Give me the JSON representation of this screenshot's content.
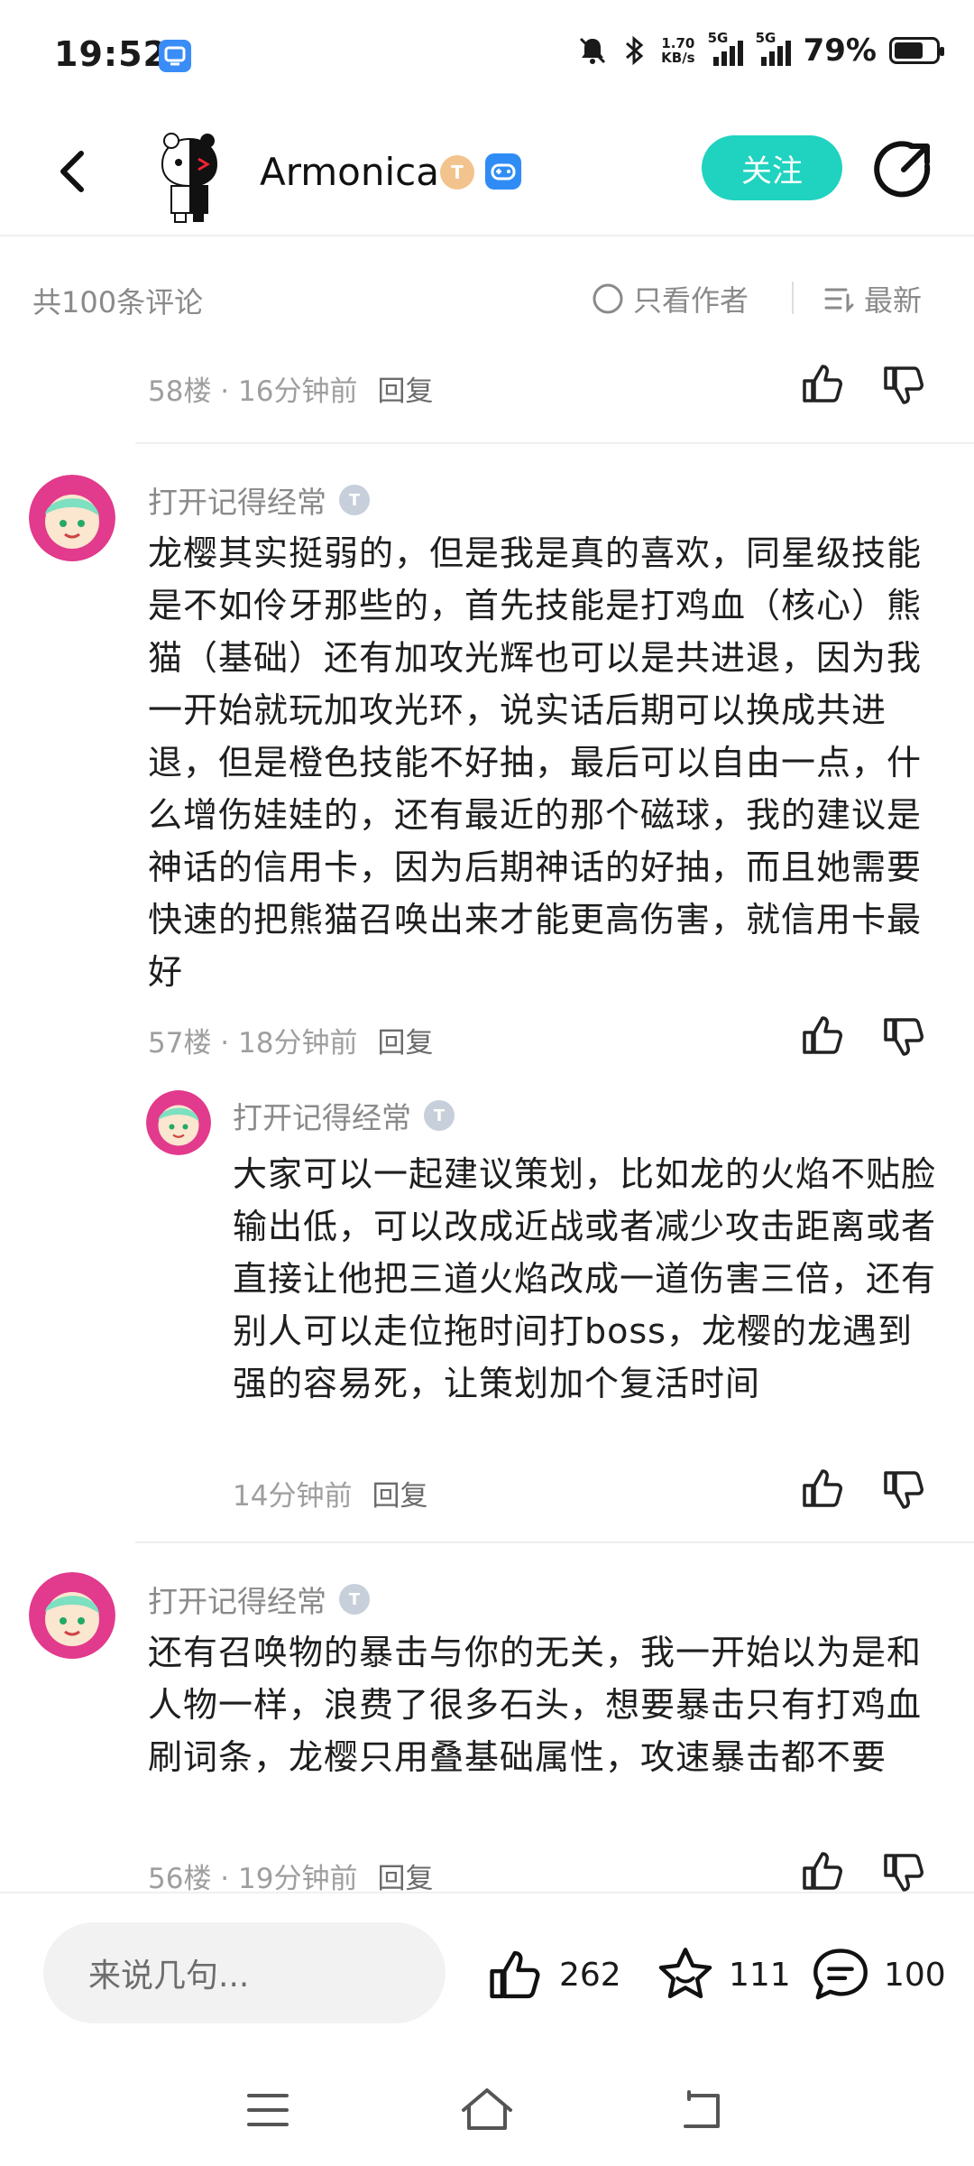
{
  "status_bar": {
    "time": "19:52",
    "net_speed_top": "1.70",
    "net_speed_unit": "KB/s",
    "signal_1": "5G",
    "signal_2": "5G",
    "battery": "79%"
  },
  "header": {
    "username": "Armonica",
    "badge_level": "T",
    "follow_label": "关注"
  },
  "comment_bar": {
    "total": "共100条评论",
    "author_only": "只看作者",
    "sort": "最新"
  },
  "comments": [
    {
      "meta": "58楼 · 16分钟前",
      "reply": "回复"
    },
    {
      "name": "打开记得经常",
      "level": "T",
      "text": "龙樱其实挺弱的，但是我是真的喜欢，同星级技能是不如伶牙那些的，首先技能是打鸡血（核心）熊猫（基础）还有加攻光辉也可以是共进退，因为我一开始就玩加攻光环，说实话后期可以换成共进退，但是橙色技能不好抽，最后可以自由一点，什么增伤娃娃的，还有最近的那个磁球，我的建议是神话的信用卡，因为后期神话的好抽，而且她需要快速的把熊猫召唤出来才能更高伤害，就信用卡最好",
      "meta": "57楼 · 18分钟前",
      "reply": "回复"
    },
    {
      "name": "打开记得经常",
      "level": "T",
      "text": "大家可以一起建议策划，比如龙的火焰不贴脸输出低，可以改成近战或者减少攻击距离或者直接让他把三道火焰改成一道伤害三倍，还有别人可以走位拖时间打boss，龙樱的龙遇到强的容易死，让策划加个复活时间",
      "meta": "14分钟前",
      "reply": "回复"
    },
    {
      "name": "打开记得经常",
      "level": "T",
      "text": "还有召唤物的暴击与你的无关，我一开始以为是和人物一样，浪费了很多石头，想要暴击只有打鸡血刷词条，龙樱只用叠基础属性，攻速暴击都不要",
      "meta": "56楼 · 19分钟前",
      "reply": "回复"
    }
  ],
  "bottom_bar": {
    "placeholder": "来说几句...",
    "likes": "262",
    "stars": "111",
    "comments": "100"
  },
  "colors": {
    "accent": "#1fd3c0",
    "meta_gray": "#9e9e9e"
  }
}
